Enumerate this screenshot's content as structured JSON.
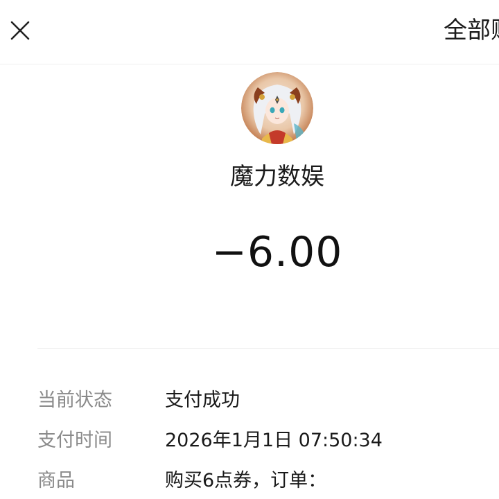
{
  "header": {
    "close_icon": "close-icon",
    "right_link": "全部账单"
  },
  "merchant": {
    "avatar_icon": "merchant-avatar",
    "name": "魔力数娱"
  },
  "transaction": {
    "amount": "−6.00"
  },
  "details": [
    {
      "label": "当前状态",
      "value": "支付成功"
    },
    {
      "label": "支付时间",
      "value": "2026年1月1日 07:50:34"
    },
    {
      "label": "商品",
      "value": "购买6点券，订单："
    }
  ]
}
